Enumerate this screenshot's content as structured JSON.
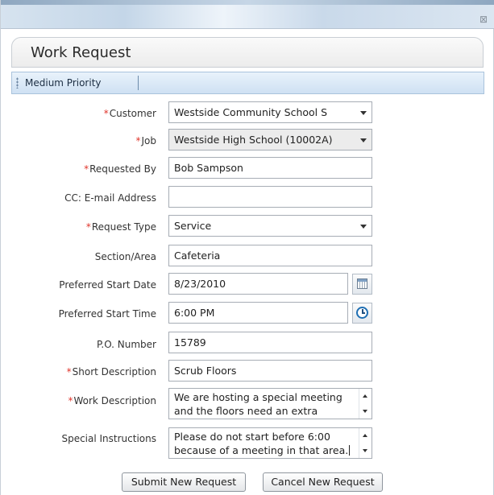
{
  "window": {
    "close_label": "⊠"
  },
  "form": {
    "title": "Work Request",
    "priority_label": "Medium Priority",
    "required_mark": "*",
    "customer": {
      "label": "Customer",
      "value": "Westside Community School S"
    },
    "job": {
      "label": "Job",
      "value": "Westside High School (10002A)"
    },
    "requested_by": {
      "label": "Requested By",
      "value": "Bob Sampson"
    },
    "cc_email": {
      "label": "CC: E-mail Address",
      "value": ""
    },
    "request_type": {
      "label": "Request Type",
      "value": "Service"
    },
    "section_area": {
      "label": "Section/Area",
      "value": "Cafeteria"
    },
    "preferred_start_date": {
      "label": "Preferred Start Date",
      "value": "8/23/2010"
    },
    "preferred_start_time": {
      "label": "Preferred Start Time",
      "value": "6:00 PM"
    },
    "po_number": {
      "label": "P.O. Number",
      "value": "15789"
    },
    "short_description": {
      "label": "Short Description",
      "value": "Scrub Floors"
    },
    "work_description": {
      "label": "Work Description",
      "value": "We are hosting a special meeting and the floors need an extra cleaning."
    },
    "special_instructions": {
      "label": "Special Instructions",
      "value": "Please do not start before 6:00 because of a meeting in that area."
    }
  },
  "actions": {
    "submit_label": "Submit New Request",
    "cancel_label": "Cancel New Request"
  }
}
